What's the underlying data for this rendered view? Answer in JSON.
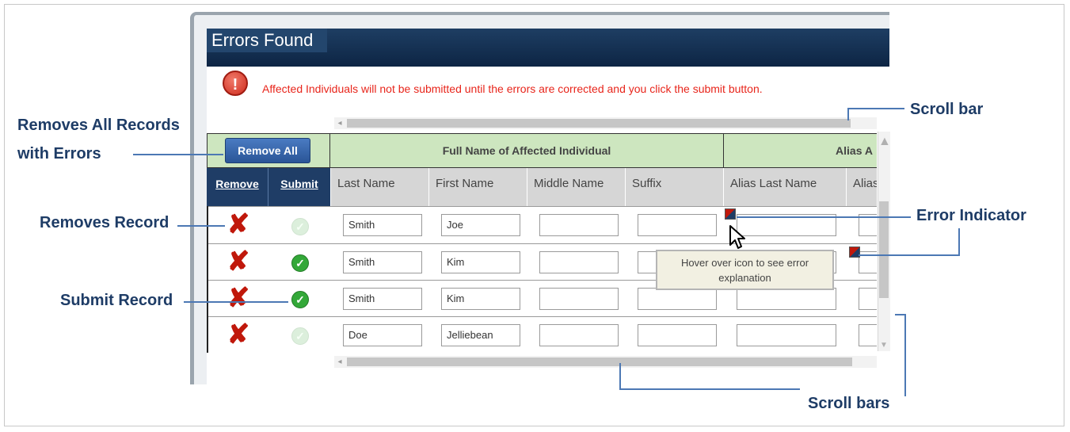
{
  "dialog": {
    "title": "Errors Found",
    "alert_message": "Affected Individuals will not be submitted until the errors are corrected and you click the submit button."
  },
  "table": {
    "remove_all_label": "Remove All",
    "group_headers": [
      "Full Name of Affected Individual",
      "Alias A"
    ],
    "col_remove": "Remove",
    "col_submit": "Submit",
    "columns": [
      "Last Name",
      "First Name",
      "Middle Name",
      "Suffix",
      "Alias Last Name",
      "Alias"
    ],
    "rows": [
      {
        "last": "Smith",
        "first": "Joe",
        "middle": "",
        "suffix": "",
        "alias_last": "",
        "submit_enabled": false
      },
      {
        "last": "Smith",
        "first": "Kim",
        "middle": "",
        "suffix": "",
        "alias_last": "",
        "submit_enabled": true
      },
      {
        "last": "Smith",
        "first": "Kim",
        "middle": "",
        "suffix": "",
        "alias_last": "",
        "submit_enabled": true
      },
      {
        "last": "Doe",
        "first": "Jelliebean",
        "middle": "",
        "suffix": "",
        "alias_last": "",
        "submit_enabled": false
      }
    ],
    "remove_icon": "x-icon",
    "submit_icon": "check-circle-icon"
  },
  "tooltip": {
    "text": "Hover over icon to see error explanation"
  },
  "callouts": {
    "remove_all_line1": "Removes All Records",
    "remove_all_line2": "with Errors",
    "removes_record": "Removes Record",
    "submit_record": "Submit Record",
    "scroll_bar": "Scroll bar",
    "error_indicator": "Error Indicator",
    "scroll_bars": "Scroll bars"
  },
  "colors": {
    "title_bar": "#0d2544",
    "alert_red": "#e8251b",
    "header_green": "#cde6bf",
    "header_blue": "#1f3d66",
    "callout_text": "#1e3c66",
    "callout_line": "#4c78b4"
  }
}
